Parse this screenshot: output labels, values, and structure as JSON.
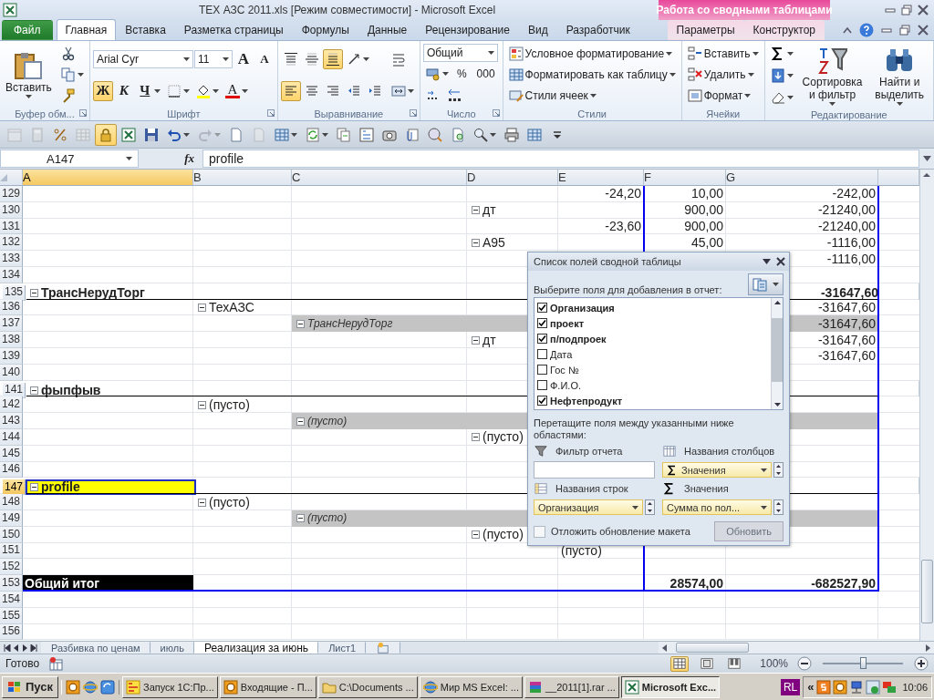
{
  "window": {
    "title": "TEX АЗС 2011.xls  [Режим совместимости]  -  Microsoft Excel",
    "context_title": "Работа со сводными таблицами"
  },
  "tabs": [
    {
      "label": "Файл",
      "kind": "file",
      "selected": false
    },
    {
      "label": "Главная",
      "kind": "normal",
      "selected": true
    },
    {
      "label": "Вставка",
      "kind": "normal",
      "selected": false
    },
    {
      "label": "Разметка страницы",
      "kind": "normal",
      "selected": false
    },
    {
      "label": "Формулы",
      "kind": "normal",
      "selected": false
    },
    {
      "label": "Данные",
      "kind": "normal",
      "selected": false
    },
    {
      "label": "Рецензирование",
      "kind": "normal",
      "selected": false
    },
    {
      "label": "Вид",
      "kind": "normal",
      "selected": false
    },
    {
      "label": "Разработчик",
      "kind": "normal",
      "selected": false
    },
    {
      "label": "Параметры",
      "kind": "context",
      "selected": false
    },
    {
      "label": "Конструктор",
      "kind": "context",
      "selected": false
    }
  ],
  "ribbon": {
    "groups": [
      {
        "title": "Буфер обм...",
        "launcher": true,
        "columns": [
          [
            [
              {
                "kind": "paste",
                "label": "Вставить",
                "caret": true
              }
            ]
          ],
          [
            [
              {
                "kind": "cut"
              }
            ],
            [
              {
                "kind": "copy",
                "caret": true
              }
            ],
            [
              {
                "kind": "painter"
              }
            ]
          ]
        ]
      },
      {
        "title": "Шрифт",
        "launcher": true,
        "columns": [
          [
            [
              {
                "kind": "font_field",
                "value": "Arial Cyr"
              },
              {
                "kind": "size_field",
                "value": "11"
              },
              {
                "kind": "grow",
                "text": "A"
              },
              {
                "kind": "shrink",
                "text": "A"
              }
            ],
            [
              {
                "kind": "bold",
                "text": "Ж",
                "selected": true
              },
              {
                "kind": "italic",
                "text": "К",
                "selected": false
              },
              {
                "kind": "underline",
                "text": "Ч",
                "selected": false,
                "caret": true
              },
              {
                "kind": "borders",
                "caret": true
              },
              {
                "kind": "fill",
                "caret": true
              },
              {
                "kind": "font_color",
                "text": "A",
                "caret": true
              }
            ]
          ]
        ]
      },
      {
        "title": "Выравнивание",
        "launcher": true,
        "columns": [
          [
            [
              {
                "kind": "align_top",
                "selected": false
              },
              {
                "kind": "align_middle",
                "selected": false
              },
              {
                "kind": "align_bottom",
                "selected": true
              },
              {
                "kind": "orientation",
                "caret": true
              }
            ],
            [
              {
                "kind": "align_left",
                "selected": true
              },
              {
                "kind": "align_center",
                "selected": false
              },
              {
                "kind": "align_right",
                "selected": false
              },
              {
                "kind": "indent_dec"
              },
              {
                "kind": "indent_inc"
              }
            ]
          ],
          [
            [
              {
                "kind": "wrap"
              }
            ],
            [
              {
                "kind": "merge",
                "caret": true
              }
            ]
          ]
        ]
      },
      {
        "title": "Число",
        "launcher": true,
        "columns": [
          [
            [
              {
                "kind": "format_field",
                "value": "Общий"
              }
            ],
            [
              {
                "kind": "currency",
                "caret": true
              },
              {
                "kind": "percent",
                "text": "%"
              },
              {
                "kind": "thousands",
                "text": "000"
              }
            ],
            [
              {
                "kind": "inc_decimal"
              },
              {
                "kind": "dec_decimal"
              }
            ]
          ]
        ]
      },
      {
        "title": "Стили",
        "launcher": false,
        "columns": [
          [
            [
              {
                "kind": "cond",
                "label": "Условное форматирование",
                "caret": true
              }
            ],
            [
              {
                "kind": "table",
                "label": "Форматировать как таблицу",
                "caret": true
              }
            ],
            [
              {
                "kind": "cellstyles",
                "label": "Стили ячеек",
                "caret": true
              }
            ]
          ]
        ]
      },
      {
        "title": "Ячейки",
        "launcher": false,
        "columns": [
          [
            [
              {
                "kind": "cell_insert",
                "label": "Вставить",
                "caret": true
              }
            ],
            [
              {
                "kind": "cell_delete",
                "label": "Удалить",
                "caret": true
              }
            ],
            [
              {
                "kind": "cell_format",
                "label": "Формат",
                "caret": true
              }
            ]
          ]
        ]
      },
      {
        "title": "Редактирование",
        "launcher": false,
        "columns": [
          [
            [
              {
                "kind": "sum",
                "caret": true
              }
            ],
            [
              {
                "kind": "fill_down",
                "caret": true
              }
            ],
            [
              {
                "kind": "clear",
                "caret": true
              }
            ]
          ],
          [
            [
              {
                "kind": "sort",
                "label": "Сортировка и фильтр",
                "caret": true
              }
            ]
          ],
          [
            [
              {
                "kind": "find",
                "label": "Найти и выделить",
                "caret": true
              }
            ]
          ]
        ]
      }
    ]
  },
  "quick_access": [
    {
      "kind": "calendar",
      "disabled": true,
      "selected": false
    },
    {
      "kind": "calc",
      "disabled": true,
      "selected": false
    },
    {
      "kind": "percent_paint",
      "disabled": false,
      "selected": false
    },
    {
      "kind": "grid",
      "disabled": true,
      "selected": false
    },
    {
      "kind": "lock",
      "disabled": false,
      "selected": true
    },
    {
      "kind": "excel",
      "disabled": false,
      "selected": false
    },
    {
      "kind": "save",
      "disabled": false,
      "selected": false
    },
    {
      "kind": "undo",
      "disabled": false,
      "selected": false,
      "caret": true
    },
    {
      "kind": "redo",
      "disabled": true,
      "selected": false,
      "caret": true
    },
    {
      "kind": "new",
      "disabled": false,
      "selected": false
    },
    {
      "kind": "page",
      "disabled": true,
      "selected": false
    },
    {
      "kind": "table",
      "disabled": false,
      "selected": false,
      "caret": true
    },
    {
      "kind": "refresh",
      "disabled": false,
      "selected": false,
      "caret": true
    },
    {
      "kind": "pages",
      "disabled": false,
      "selected": false
    },
    {
      "kind": "form",
      "disabled": false,
      "selected": false
    },
    {
      "kind": "camera",
      "disabled": false,
      "selected": false
    },
    {
      "kind": "clip",
      "disabled": false,
      "selected": false
    },
    {
      "kind": "formula",
      "disabled": false,
      "selected": false
    },
    {
      "kind": "preview",
      "disabled": false,
      "selected": false
    },
    {
      "kind": "magnifier",
      "disabled": false,
      "selected": false,
      "caret": true
    },
    {
      "kind": "printer",
      "disabled": false,
      "selected": false
    },
    {
      "kind": "grid2",
      "disabled": false,
      "selected": false
    },
    {
      "kind": "customize",
      "disabled": false,
      "selected": false
    }
  ],
  "formula_bar": {
    "name_box": "A147",
    "fx": "fx",
    "value": "profile"
  },
  "sheet": {
    "columns": [
      {
        "label": "A",
        "selected": true
      },
      {
        "label": "B",
        "selected": false
      },
      {
        "label": "C",
        "selected": false
      },
      {
        "label": "D",
        "selected": false
      },
      {
        "label": "E",
        "selected": false
      },
      {
        "label": "F",
        "selected": false
      },
      {
        "label": "G",
        "selected": false
      }
    ],
    "rows": [
      {
        "number": "129",
        "kind": "plain",
        "selected": false,
        "cells": [
          null,
          null,
          null,
          null,
          {
            "kind": "value",
            "text": "-24,20"
          },
          {
            "kind": "value",
            "text": "10,00"
          },
          {
            "kind": "value",
            "text": "-242,00"
          }
        ]
      },
      {
        "number": "130",
        "kind": "plain",
        "selected": false,
        "cells": [
          null,
          null,
          null,
          {
            "kind": "item",
            "text": "дт",
            "expanded": true
          },
          null,
          {
            "kind": "value",
            "text": "900,00"
          },
          {
            "kind": "value",
            "text": "-21240,00"
          }
        ]
      },
      {
        "number": "131",
        "kind": "plain",
        "selected": false,
        "cells": [
          null,
          null,
          null,
          null,
          {
            "kind": "value",
            "text": "-23,60"
          },
          {
            "kind": "value",
            "text": "900,00"
          },
          {
            "kind": "value",
            "text": "-21240,00"
          }
        ]
      },
      {
        "number": "132",
        "kind": "plain",
        "selected": false,
        "cells": [
          null,
          null,
          null,
          {
            "kind": "item",
            "text": "A95",
            "expanded": true
          },
          null,
          {
            "kind": "value",
            "text": "45,00"
          },
          {
            "kind": "value",
            "text": "-1116,00"
          }
        ]
      },
      {
        "number": "133",
        "kind": "plain",
        "selected": false,
        "cells": [
          null,
          null,
          null,
          null,
          null,
          null,
          {
            "kind": "value",
            "text": "-1116,00"
          }
        ]
      },
      {
        "number": "134",
        "kind": "plain",
        "selected": false,
        "cells": []
      },
      {
        "number": "135",
        "kind": "group",
        "selected": false,
        "cells": [
          {
            "kind": "item",
            "text": "ТрансНерудТорг",
            "expanded": true
          },
          null,
          null,
          null,
          null,
          null,
          {
            "kind": "value",
            "text": "-31647,60"
          }
        ]
      },
      {
        "number": "136",
        "kind": "plain",
        "selected": false,
        "cells": [
          null,
          {
            "kind": "item",
            "text": "ТехАЗС",
            "expanded": true
          },
          null,
          null,
          null,
          null,
          {
            "kind": "value",
            "text": "-31647,60"
          }
        ]
      },
      {
        "number": "137",
        "kind": "band",
        "selected": false,
        "cells": [
          null,
          null,
          {
            "kind": "item",
            "text": "ТрансНерудТорг",
            "expanded": true
          },
          null,
          null,
          null,
          {
            "kind": "value",
            "text": "-31647,60"
          }
        ]
      },
      {
        "number": "138",
        "kind": "plain",
        "selected": false,
        "cells": [
          null,
          null,
          null,
          {
            "kind": "item",
            "text": "дт",
            "expanded": true
          },
          null,
          null,
          {
            "kind": "value",
            "text": "-31647,60"
          }
        ]
      },
      {
        "number": "139",
        "kind": "plain",
        "selected": false,
        "cells": [
          null,
          null,
          null,
          null,
          null,
          null,
          {
            "kind": "value",
            "text": "-31647,60"
          }
        ]
      },
      {
        "number": "140",
        "kind": "plain",
        "selected": false,
        "cells": []
      },
      {
        "number": "141",
        "kind": "group",
        "selected": false,
        "cells": [
          {
            "kind": "item",
            "text": "фыпфыв",
            "expanded": true
          }
        ]
      },
      {
        "number": "142",
        "kind": "plain",
        "selected": false,
        "cells": [
          null,
          {
            "kind": "item",
            "text": "(пусто)",
            "expanded": true
          }
        ]
      },
      {
        "number": "143",
        "kind": "band",
        "selected": false,
        "cells": [
          null,
          null,
          {
            "kind": "item",
            "text": "(пусто)",
            "expanded": true
          }
        ]
      },
      {
        "number": "144",
        "kind": "plain",
        "selected": false,
        "cells": [
          null,
          null,
          null,
          {
            "kind": "item",
            "text": "(пусто)",
            "expanded": true
          }
        ]
      },
      {
        "number": "145",
        "kind": "plain",
        "selected": false,
        "cells": []
      },
      {
        "number": "146",
        "kind": "plain",
        "selected": false,
        "cells": []
      },
      {
        "number": "147",
        "kind": "group",
        "selected": true,
        "cells": [
          {
            "kind": "item",
            "text": "profile",
            "expanded": true,
            "filled": true,
            "selected": true
          }
        ]
      },
      {
        "number": "148",
        "kind": "plain",
        "selected": false,
        "cells": [
          null,
          {
            "kind": "item",
            "text": "(пусто)",
            "expanded": true
          }
        ]
      },
      {
        "number": "149",
        "kind": "band",
        "selected": false,
        "cells": [
          null,
          null,
          {
            "kind": "item",
            "text": "(пусто)",
            "expanded": true
          }
        ]
      },
      {
        "number": "150",
        "kind": "plain",
        "selected": false,
        "cells": [
          null,
          null,
          null,
          {
            "kind": "item",
            "text": "(пусто)",
            "expanded": true
          }
        ]
      },
      {
        "number": "151",
        "kind": "plain",
        "selected": false,
        "cells": [
          null,
          null,
          null,
          null,
          {
            "kind": "label",
            "text": "(пусто)"
          }
        ]
      },
      {
        "number": "152",
        "kind": "plain",
        "selected": false,
        "cells": []
      },
      {
        "number": "153",
        "kind": "grand_total",
        "selected": false,
        "cells": [
          {
            "kind": "label",
            "text": "Общий итог"
          },
          null,
          null,
          null,
          null,
          {
            "kind": "value",
            "text": "28574,00"
          },
          {
            "kind": "value",
            "text": "-682527,90"
          }
        ]
      },
      {
        "number": "154",
        "kind": "plain",
        "selected": false,
        "cells": []
      },
      {
        "number": "155",
        "kind": "plain",
        "selected": false,
        "cells": []
      },
      {
        "number": "156",
        "kind": "plain",
        "selected": false,
        "cells": []
      }
    ]
  },
  "pivot_panel": {
    "title": "Список полей сводной таблицы",
    "prompt": "Выберите поля для добавления в отчет:",
    "fields": [
      {
        "label": "Организация",
        "checked": true
      },
      {
        "label": "проект",
        "checked": true
      },
      {
        "label": "п/подпроек",
        "checked": true
      },
      {
        "label": "Дата",
        "checked": false
      },
      {
        "label": "Гос №",
        "checked": false
      },
      {
        "label": "Ф.И.О.",
        "checked": false
      },
      {
        "label": "Нефтепродукт",
        "checked": true
      }
    ],
    "hint": "Перетащите поля между указанными ниже областями:",
    "areas": [
      {
        "kind": "filter",
        "label": "Фильтр отчета"
      },
      {
        "kind": "columns",
        "label": "Названия столбцов",
        "item": {
          "kind": "values",
          "label": "Значения"
        }
      },
      {
        "kind": "rows",
        "label": "Названия строк",
        "item": {
          "kind": "field",
          "label": "Организация"
        }
      },
      {
        "kind": "values",
        "label": "Значения",
        "item": {
          "kind": "field",
          "label": "Сумма по пол..."
        }
      }
    ],
    "defer": {
      "label": "Отложить обновление макета",
      "checked": false
    },
    "update_button": {
      "label": "Обновить",
      "disabled": true
    }
  },
  "sheet_tabs": [
    {
      "label": "Разбивка по ценам",
      "selected": false
    },
    {
      "label": "июль",
      "selected": false
    },
    {
      "label": "Реализация за июнь",
      "selected": true
    },
    {
      "label": "Лист1",
      "selected": false
    }
  ],
  "status_bar": {
    "status": "Готово",
    "views": [
      {
        "kind": "normal",
        "selected": true
      },
      {
        "kind": "layout",
        "selected": false
      },
      {
        "kind": "page_break",
        "selected": false
      }
    ],
    "zoom": "100%",
    "zoom_slider": {
      "level": 0.5
    }
  },
  "taskbar": {
    "start": "Пуск",
    "quick_launch": [
      {
        "kind": "outlook"
      },
      {
        "kind": "browser"
      },
      {
        "kind": "browser_refresh"
      }
    ],
    "tasks": [
      {
        "kind": "onec",
        "label": "Запуск 1С:Пр...",
        "selected": false
      },
      {
        "kind": "outlook",
        "label": "Входящие - П...",
        "selected": false
      },
      {
        "kind": "folder",
        "label": "C:\\Documents ...",
        "selected": false
      },
      {
        "kind": "browser",
        "label": "Мир MS Excel: ...",
        "selected": false
      },
      {
        "kind": "archive",
        "label": "__2011[1].rar ...",
        "selected": false
      },
      {
        "kind": "excel",
        "label": "Microsoft Exc...",
        "selected": true
      }
    ],
    "language": "RL",
    "expand": "«",
    "tray": [
      {
        "kind": "s_app"
      },
      {
        "kind": "outlook"
      },
      {
        "kind": "network"
      },
      {
        "kind": "update"
      },
      {
        "kind": "monitors"
      }
    ],
    "clock": "10:06"
  }
}
